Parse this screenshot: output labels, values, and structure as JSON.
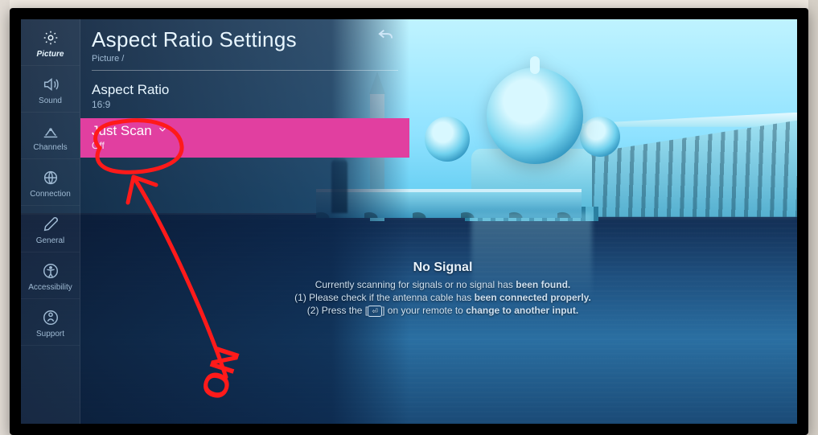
{
  "header": {
    "title": "Aspect Ratio Settings",
    "breadcrumb": "Picture /"
  },
  "sidebar": {
    "items": [
      {
        "label": "Picture",
        "icon": "picture-icon",
        "active": true
      },
      {
        "label": "Sound",
        "icon": "sound-icon",
        "active": false
      },
      {
        "label": "Channels",
        "icon": "channels-icon",
        "active": false
      },
      {
        "label": "Connection",
        "icon": "connection-icon",
        "active": false
      },
      {
        "label": "General",
        "icon": "general-icon",
        "active": false
      },
      {
        "label": "Accessibility",
        "icon": "accessibility-icon",
        "active": false
      },
      {
        "label": "Support",
        "icon": "support-icon",
        "active": false
      }
    ]
  },
  "settings": {
    "aspect_ratio": {
      "label": "Aspect Ratio",
      "value": "16:9"
    },
    "just_scan": {
      "label": "Just Scan",
      "value": "Off",
      "selected": true
    }
  },
  "nosignal": {
    "title": "No Signal",
    "line1a": "Currently scanning for signals or no signal has ",
    "line1b": "been found.",
    "line2a": "(1) Please check if the antenna cable has ",
    "line2b": "been connected properly.",
    "line3a": "(2) Press the [",
    "line3b": "] on your remote to ",
    "line3c": "change to another input."
  },
  "annotation": {
    "text": "ON",
    "color": "#ff1a1a"
  }
}
